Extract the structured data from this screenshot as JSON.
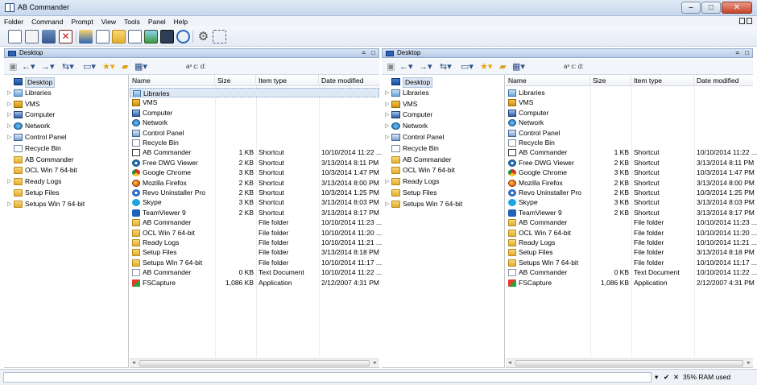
{
  "window": {
    "title": "AB Commander"
  },
  "menu": [
    "Folder",
    "Command",
    "Prompt",
    "View",
    "Tools",
    "Panel",
    "Help"
  ],
  "toolbar_icons": [
    "copy-icon",
    "paste-icon",
    "rename-icon",
    "delete-icon",
    "move-icon",
    "properties-icon",
    "new-folder-icon",
    "view-icon",
    "image-view-icon",
    "command-prompt-icon",
    "search-icon",
    "settings-icon",
    "fullscreen-icon"
  ],
  "panes": [
    {
      "id": "left",
      "header": "Desktop"
    },
    {
      "id": "right",
      "header": "Desktop"
    }
  ],
  "pane_tool_labels": {
    "drives": "aˢ c: d:"
  },
  "tree": [
    {
      "label": "Desktop",
      "icon": "desktop-icon",
      "exp": "",
      "selected": true
    },
    {
      "label": "Libraries",
      "icon": "library-icon",
      "exp": "▷"
    },
    {
      "label": "VMS",
      "icon": "user-folder-icon",
      "exp": "▷"
    },
    {
      "label": "Computer",
      "icon": "computer-icon",
      "exp": "▷"
    },
    {
      "label": "Network",
      "icon": "network-icon",
      "exp": "▷"
    },
    {
      "label": "Control Panel",
      "icon": "control-panel-icon",
      "exp": "▷"
    },
    {
      "label": "Recycle Bin",
      "icon": "recycle-bin-icon",
      "exp": ""
    },
    {
      "label": "AB Commander",
      "icon": "folder-icon",
      "exp": ""
    },
    {
      "label": "OCL Win 7 64-bit",
      "icon": "folder-icon",
      "exp": ""
    },
    {
      "label": "Ready Logs",
      "icon": "folder-icon",
      "exp": "▷"
    },
    {
      "label": "Setup Files",
      "icon": "folder-icon",
      "exp": ""
    },
    {
      "label": "Setups Win 7 64-bit",
      "icon": "folder-icon",
      "exp": "▷"
    }
  ],
  "columns": {
    "name": "Name",
    "size": "Size",
    "type": "Item type",
    "date": "Date modified"
  },
  "files": [
    {
      "name": "Libraries",
      "size": "",
      "type": "",
      "date": "",
      "icon": "library-icon"
    },
    {
      "name": "VMS",
      "size": "",
      "type": "",
      "date": "",
      "icon": "user-folder-icon"
    },
    {
      "name": "Computer",
      "size": "",
      "type": "",
      "date": "",
      "icon": "computer-icon"
    },
    {
      "name": "Network",
      "size": "",
      "type": "",
      "date": "",
      "icon": "network-icon"
    },
    {
      "name": "Control Panel",
      "size": "",
      "type": "",
      "date": "",
      "icon": "control-panel-icon"
    },
    {
      "name": "Recycle Bin",
      "size": "",
      "type": "",
      "date": "",
      "icon": "recycle-bin-icon"
    },
    {
      "name": "AB Commander",
      "size": "1 KB",
      "type": "Shortcut",
      "date": "10/10/2014 11:22 ...",
      "icon": "app-shortcut-icon"
    },
    {
      "name": "Free DWG Viewer",
      "size": "2 KB",
      "type": "Shortcut",
      "date": "3/13/2014 8:11 PM",
      "icon": "dwg-viewer-icon"
    },
    {
      "name": "Google Chrome",
      "size": "3 KB",
      "type": "Shortcut",
      "date": "10/3/2014 1:47 PM",
      "icon": "chrome-icon"
    },
    {
      "name": "Mozilla Firefox",
      "size": "2 KB",
      "type": "Shortcut",
      "date": "3/13/2014 8:00 PM",
      "icon": "firefox-icon"
    },
    {
      "name": "Revo Uninstaller Pro",
      "size": "2 KB",
      "type": "Shortcut",
      "date": "10/3/2014 1:25 PM",
      "icon": "revo-icon"
    },
    {
      "name": "Skype",
      "size": "3 KB",
      "type": "Shortcut",
      "date": "3/13/2014 8:03 PM",
      "icon": "skype-icon"
    },
    {
      "name": "TeamViewer 9",
      "size": "2 KB",
      "type": "Shortcut",
      "date": "3/13/2014 8:17 PM",
      "icon": "teamviewer-icon"
    },
    {
      "name": "AB Commander",
      "size": "",
      "type": "File folder",
      "date": "10/10/2014 11:23 ...",
      "icon": "folder-icon"
    },
    {
      "name": "OCL Win 7 64-bit",
      "size": "",
      "type": "File folder",
      "date": "10/10/2014 11:20 ...",
      "icon": "folder-icon"
    },
    {
      "name": "Ready Logs",
      "size": "",
      "type": "File folder",
      "date": "10/10/2014 11:21 ...",
      "icon": "folder-icon"
    },
    {
      "name": "Setup Files",
      "size": "",
      "type": "File folder",
      "date": "3/13/2014 8:18 PM",
      "icon": "folder-icon"
    },
    {
      "name": "Setups Win 7 64-bit",
      "size": "",
      "type": "File folder",
      "date": "10/10/2014 11:17 ...",
      "icon": "folder-icon"
    },
    {
      "name": "AB Commander",
      "size": "0 KB",
      "type": "Text Document",
      "date": "10/10/2014 11:22 ...",
      "icon": "text-document-icon"
    },
    {
      "name": "FSCapture",
      "size": "1,086 KB",
      "type": "Application",
      "date": "2/12/2007 4:31 PM",
      "icon": "fscapture-icon"
    }
  ],
  "status": {
    "ram": "35% RAM used"
  }
}
